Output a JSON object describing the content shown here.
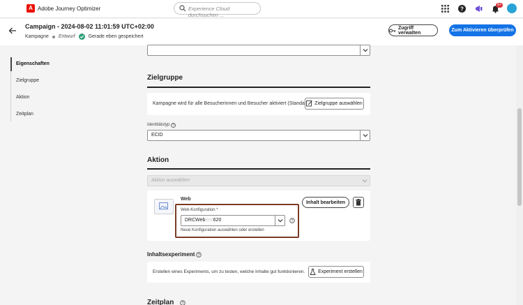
{
  "app": {
    "logo_letter": "A",
    "name": "Adobe Journey Optimizer"
  },
  "search": {
    "placeholder": "Experience Cloud durchsuchen ..."
  },
  "topbar_icons": [
    "apps-grid-icon",
    "help-icon",
    "megaphone-icon",
    "notifications-icon",
    "avatar"
  ],
  "notification_badge": "9+",
  "campaign": {
    "title": "Campaign - 2024-08-02 11:01:59 UTC+02:00",
    "type": "Kampagne",
    "status": "Entwurf",
    "save_state": "Gerade eben gespeichert"
  },
  "header_buttons": {
    "access": "Zugriff verwalten",
    "activate": "Zum Aktivieren überprüfen"
  },
  "leftnav": {
    "items": [
      "Eigenschaften",
      "Zielgruppe",
      "Aktion",
      "Zeitplan"
    ],
    "active": "Eigenschaften"
  },
  "audience": {
    "title": "Zielgruppe",
    "description": "Kampagne wird für alle Besucherinnen und Besucher aktiviert (Standard)",
    "select_button": "Zielgruppe auswählen",
    "identity_label": "Identitätstyp",
    "identity_value": "ECID"
  },
  "action": {
    "title": "Aktion",
    "select_placeholder": "Aktion auswählen",
    "channel": "Web",
    "config_label": "Web-Konfiguration",
    "config_required": "*",
    "config_value_prefix": "DRCWeb",
    "config_value_masked": "test",
    "config_value_suffix": "620",
    "config_help": "Neue Konfiguration auswählen oder erstellen",
    "edit_button": "Inhalt bearbeiten"
  },
  "experiment": {
    "title": "Inhaltsexperiment",
    "description": "Erstellen eines Experiments, um zu testen, welche Inhalte gut funktionieren.",
    "create_button": "Experiment erstellen"
  },
  "schedule": {
    "title": "Zeitplan"
  },
  "colors": {
    "accent": "#1473e6",
    "brand": "#eb1000",
    "success": "#2d9d78",
    "highlight": "#7a3b25"
  }
}
